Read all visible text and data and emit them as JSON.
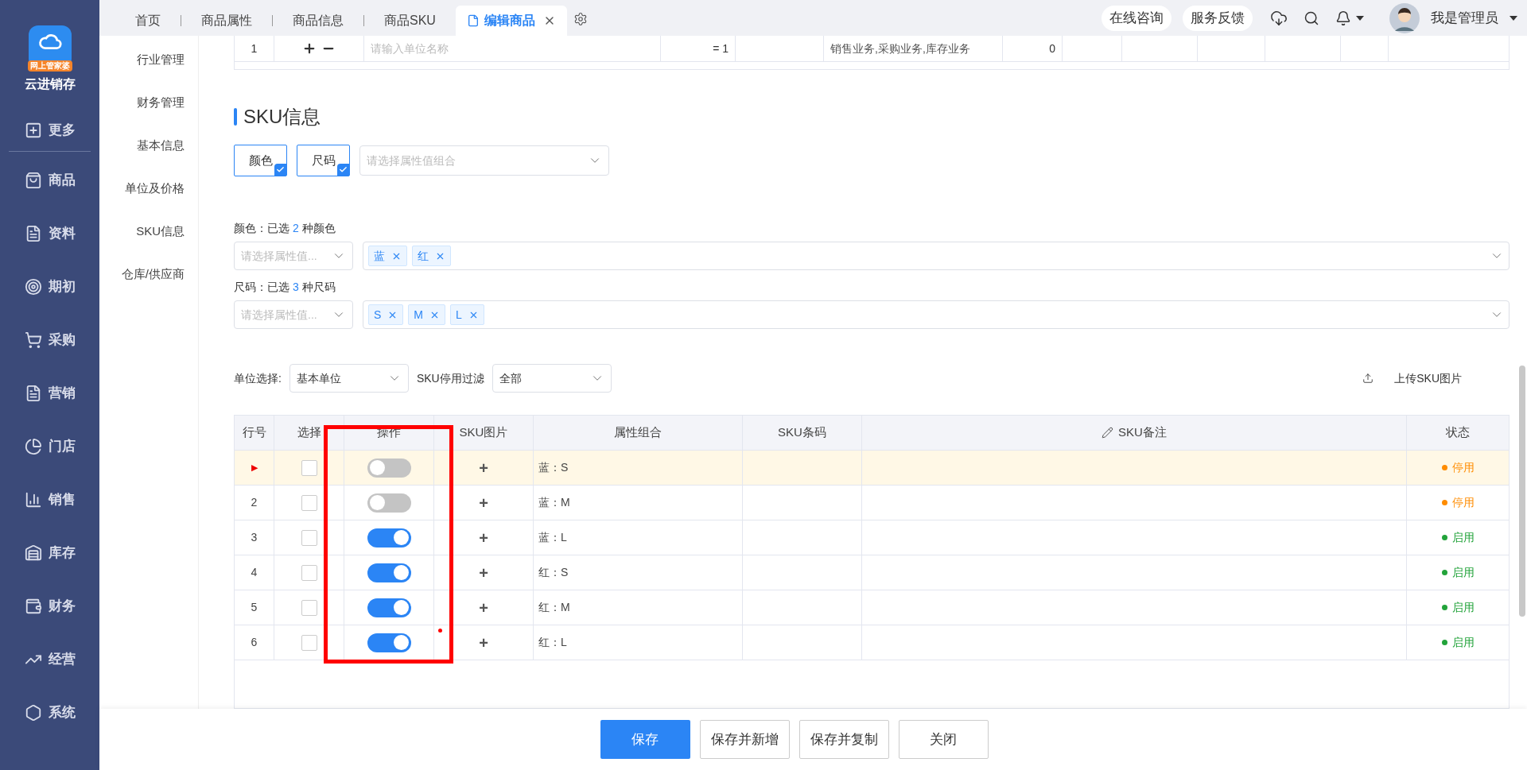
{
  "brand": {
    "badge": "网上管家婆",
    "name": "云进销存"
  },
  "nav": [
    "更多",
    "商品",
    "资料",
    "期初",
    "采购",
    "营销",
    "门店",
    "销售",
    "库存",
    "财务",
    "经营",
    "系统"
  ],
  "tabs": [
    {
      "label": "首页",
      "selected": false
    },
    {
      "label": "商品属性",
      "selected": false
    },
    {
      "label": "商品信息",
      "selected": false
    },
    {
      "label": "商品SKU",
      "selected": false
    },
    {
      "label": "编辑商品",
      "selected": true
    }
  ],
  "header_buttons": [
    "在线咨询",
    "服务反馈"
  ],
  "user": "我是管理员",
  "section_nav": [
    "行业管理",
    "财务管理",
    "基本信息",
    "单位及价格",
    "SKU信息",
    "仓库/供应商"
  ],
  "unit_row": {
    "number": "1",
    "placeholder": "请输入单位名称",
    "ratio": "= 1",
    "business": "销售业务,采购业务,库存业务",
    "count": "0"
  },
  "sku": {
    "title": "SKU信息",
    "attributes": [
      {
        "label": "颜色",
        "checked": true
      },
      {
        "label": "尺码",
        "checked": true
      }
    ],
    "combo_placeholder": "请选择属性值组合",
    "groups": [
      {
        "label": "颜色：已选",
        "count": "2",
        "unit": "种颜色",
        "placeholder": "请选择属性值...",
        "tags": [
          "蓝",
          "红"
        ]
      },
      {
        "label": "尺码：已选",
        "count": "3",
        "unit": "种尺码",
        "placeholder": "请选择属性值...",
        "tags": [
          "S",
          "M",
          "L"
        ]
      }
    ],
    "unit_label": "单位选择:",
    "unit_value": "基本单位",
    "filter_label": "SKU停用过滤",
    "filter_value": "全部",
    "upload": "上传SKU图片"
  },
  "table": {
    "columns": [
      "行号",
      "选择",
      "操作",
      "SKU图片",
      "属性组合",
      "SKU条码",
      "SKU备注",
      "状态"
    ],
    "rows": [
      {
        "number": "▶",
        "selected": true,
        "checked": false,
        "on": false,
        "add": "+",
        "combo": "蓝：S",
        "status": "停用",
        "color": "#ff8c00"
      },
      {
        "number": "2",
        "selected": false,
        "checked": false,
        "on": false,
        "add": "+",
        "combo": "蓝：M",
        "status": "停用",
        "color": "#ff8c00"
      },
      {
        "number": "3",
        "selected": false,
        "checked": false,
        "on": true,
        "add": "+",
        "combo": "蓝：L",
        "status": "启用",
        "color": "#22a33a"
      },
      {
        "number": "4",
        "selected": false,
        "checked": false,
        "on": true,
        "add": "+",
        "combo": "红：S",
        "status": "启用",
        "color": "#22a33a"
      },
      {
        "number": "5",
        "selected": false,
        "checked": false,
        "on": true,
        "add": "+",
        "combo": "红：M",
        "status": "启用",
        "color": "#22a33a"
      },
      {
        "number": "6",
        "selected": false,
        "checked": false,
        "on": true,
        "add": "+",
        "combo": "红：L",
        "status": "启用",
        "color": "#22a33a"
      }
    ]
  },
  "footer": [
    {
      "label": "保存",
      "primary": true
    },
    {
      "label": "保存并新增",
      "primary": false
    },
    {
      "label": "保存并复制",
      "primary": false
    },
    {
      "label": "关闭",
      "primary": false
    }
  ]
}
